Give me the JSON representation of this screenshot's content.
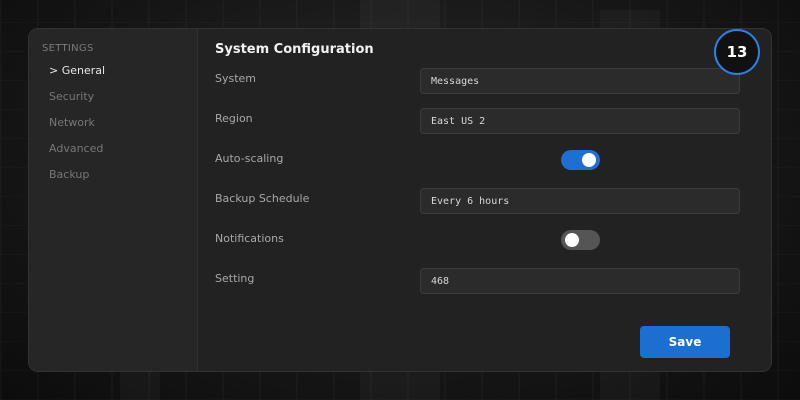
{
  "sidebar": {
    "heading": "SETTINGS",
    "items": [
      {
        "label": "> General",
        "active": true
      },
      {
        "label": "Security",
        "active": false
      },
      {
        "label": "Network",
        "active": false
      },
      {
        "label": "Advanced",
        "active": false
      },
      {
        "label": "Backup",
        "active": false
      }
    ]
  },
  "main": {
    "title": "System Configuration",
    "rows": [
      {
        "label": "System",
        "type": "text",
        "value": "Messages"
      },
      {
        "label": "Region",
        "type": "text",
        "value": "East US 2"
      },
      {
        "label": "Auto-scaling",
        "type": "toggle",
        "state": "on"
      },
      {
        "label": "Backup Schedule",
        "type": "text",
        "value": "Every 6 hours"
      },
      {
        "label": "Notifications",
        "type": "toggle",
        "state": "off"
      },
      {
        "label": "Setting",
        "type": "text",
        "value": "468"
      }
    ],
    "save_label": "Save"
  },
  "badge": {
    "count": "13"
  },
  "colors": {
    "accent": "#1a6fd0",
    "toggle_off": "#555555",
    "badge_ring": "#2f7fe6"
  }
}
